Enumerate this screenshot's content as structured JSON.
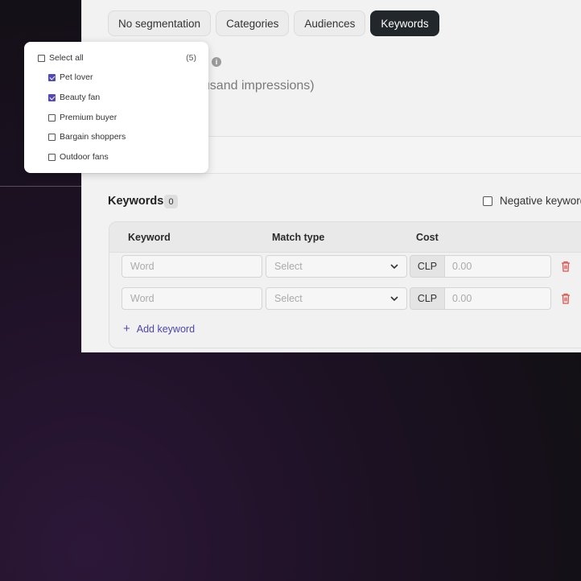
{
  "segmentation": {
    "tabs": [
      {
        "label": "No segmentation",
        "active": false
      },
      {
        "label": "Categories",
        "active": false
      },
      {
        "label": "Audiences",
        "active": false
      },
      {
        "label": "Keywords",
        "active": true
      }
    ]
  },
  "section": {
    "heading_partial": "ousand impressions)"
  },
  "keywords": {
    "title": "Keywords",
    "count": "0",
    "negative_label": "Negative keywords",
    "columns": [
      "Keyword",
      "Match type",
      "Cost"
    ],
    "rows": [
      {
        "word_placeholder": "Word",
        "match_placeholder": "Select",
        "currency": "CLP",
        "cost_placeholder": "0.00"
      },
      {
        "word_placeholder": "Word",
        "match_placeholder": "Select",
        "currency": "CLP",
        "cost_placeholder": "0.00"
      }
    ],
    "add_label": "Add keyword"
  },
  "audience_dropdown": {
    "select_all_label": "Select all",
    "select_all_count": "(5)",
    "items": [
      {
        "label": "Pet lover",
        "checked": true
      },
      {
        "label": "Beauty fan",
        "checked": true
      },
      {
        "label": "Premium buyer",
        "checked": false
      },
      {
        "label": "Bargain shoppers",
        "checked": false
      },
      {
        "label": "Outdoor fans",
        "checked": false
      }
    ]
  },
  "colors": {
    "accent": "#5249b6",
    "active_tab": "#21272b",
    "delete": "#d9534f"
  },
  "icons": {
    "info": "info-icon",
    "chevron": "chevron-down-icon",
    "delete": "trash-icon",
    "add": "plus-icon"
  }
}
